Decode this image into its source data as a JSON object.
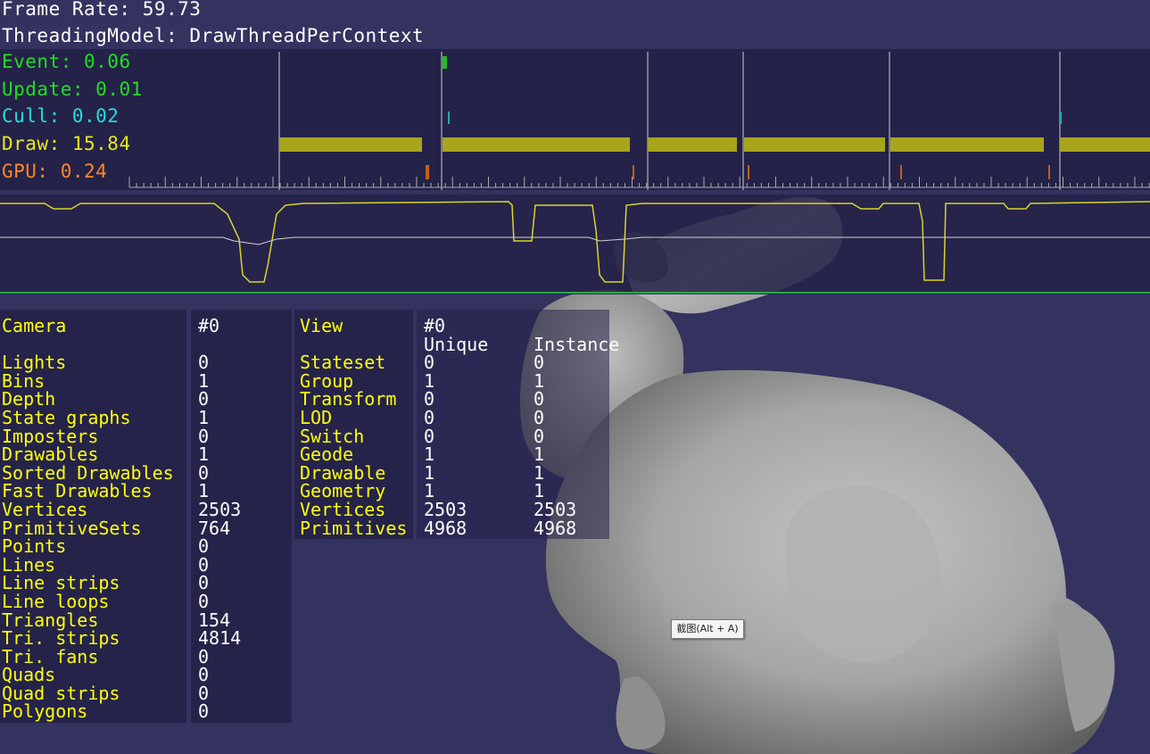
{
  "header": {
    "frame_rate_label": "Frame Rate:",
    "frame_rate_value": "59.73",
    "threading_label": "ThreadingModel:",
    "threading_value": "DrawThreadPerContext"
  },
  "timings": [
    {
      "name": "Event:",
      "value": "0.06",
      "color": "#22dd22"
    },
    {
      "name": "Update:",
      "value": "0.01",
      "color": "#22dd22"
    },
    {
      "name": "Cull:",
      "value": "0.02",
      "color": "#22dddd"
    },
    {
      "name": "Draw:",
      "value": "15.84",
      "color": "#e0e020"
    },
    {
      "name": "GPU:",
      "value": "0.24",
      "color": "#ff8822"
    }
  ],
  "colors": {
    "background": "#34325f",
    "panel": "#242248",
    "draw_bar": "#a8a41c",
    "text_yellow": "#ffff10",
    "gpu": "#c0601a"
  },
  "camera_stats": {
    "title": "Camera",
    "id": "#0",
    "rows": [
      {
        "label": "Lights",
        "value": "0"
      },
      {
        "label": "Bins",
        "value": "1"
      },
      {
        "label": "Depth",
        "value": "0"
      },
      {
        "label": "State graphs",
        "value": "1"
      },
      {
        "label": "Imposters",
        "value": "0"
      },
      {
        "label": "Drawables",
        "value": "1"
      },
      {
        "label": "Sorted Drawables",
        "value": "0"
      },
      {
        "label": "Fast Drawables",
        "value": "1"
      },
      {
        "label": "Vertices",
        "value": "2503"
      },
      {
        "label": "PrimitiveSets",
        "value": "764"
      },
      {
        "label": "Points",
        "value": "0"
      },
      {
        "label": "Lines",
        "value": "0"
      },
      {
        "label": "Line strips",
        "value": "0"
      },
      {
        "label": "Line loops",
        "value": "0"
      },
      {
        "label": "Triangles",
        "value": "154"
      },
      {
        "label": "Tri. strips",
        "value": "4814"
      },
      {
        "label": "Tri. fans",
        "value": "0"
      },
      {
        "label": "Quads",
        "value": "0"
      },
      {
        "label": "Quad strips",
        "value": "0"
      },
      {
        "label": "Polygons",
        "value": "0"
      }
    ]
  },
  "view_stats": {
    "title": "View",
    "id": "#0",
    "col_unique": "Unique",
    "col_instance": "Instance",
    "rows": [
      {
        "label": "Stateset",
        "unique": "0",
        "instance": "0"
      },
      {
        "label": "Group",
        "unique": "1",
        "instance": "1"
      },
      {
        "label": "Transform",
        "unique": "0",
        "instance": "0"
      },
      {
        "label": "LOD",
        "unique": "0",
        "instance": "0"
      },
      {
        "label": "Switch",
        "unique": "0",
        "instance": "0"
      },
      {
        "label": "Geode",
        "unique": "1",
        "instance": "1"
      },
      {
        "label": "Drawable",
        "unique": "1",
        "instance": "1"
      },
      {
        "label": "Geometry",
        "unique": "1",
        "instance": "1"
      },
      {
        "label": "Vertices",
        "unique": "2503",
        "instance": "2503"
      },
      {
        "label": "Primitives",
        "unique": "4968",
        "instance": "4968"
      }
    ]
  },
  "tooltip": "截图(Alt + A)"
}
